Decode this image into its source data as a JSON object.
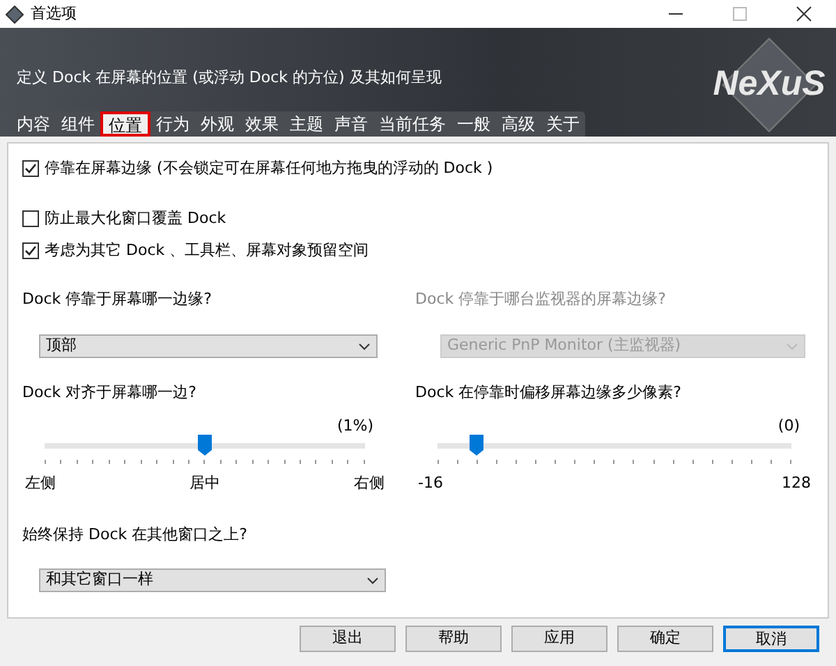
{
  "window": {
    "title": "首选项"
  },
  "header": {
    "description": "定义 Dock 在屏幕的位置 (或浮动 Dock 的方位) 及其如何呈现",
    "logo": "NeXuS"
  },
  "tabs": [
    {
      "label": "内容",
      "selected": false
    },
    {
      "label": "组件",
      "selected": false
    },
    {
      "label": "位置",
      "selected": true
    },
    {
      "label": "行为",
      "selected": false
    },
    {
      "label": "外观",
      "selected": false
    },
    {
      "label": "效果",
      "selected": false
    },
    {
      "label": "主题",
      "selected": false
    },
    {
      "label": "声音",
      "selected": false
    },
    {
      "label": "当前任务",
      "selected": false
    },
    {
      "label": "一般",
      "selected": false
    },
    {
      "label": "高级",
      "selected": false
    },
    {
      "label": "关于",
      "selected": false
    }
  ],
  "checkboxes": [
    {
      "label": "停靠在屏幕边缘 (不会锁定可在屏幕任何地方拖曳的浮动的 Dock )",
      "checked": true
    },
    {
      "label": "防止最大化窗口覆盖 Dock",
      "checked": false
    },
    {
      "label": "考虑为其它 Dock 、工具栏、屏幕对象预留空间",
      "checked": true
    }
  ],
  "edge_select": {
    "label": "Dock 停靠于屏幕哪一边缘?",
    "value": "顶部",
    "disabled": false
  },
  "monitor_select": {
    "label": "Dock 停靠于哪台监视器的屏幕边缘?",
    "value": "Generic PnP Monitor (主监视器)",
    "disabled": true
  },
  "sliders": [
    {
      "label": "Dock 对齐于屏幕哪一边?",
      "reading": "(1%)",
      "level": 0.5,
      "scale": [
        "左侧",
        "居中",
        "右侧"
      ]
    },
    {
      "label": "Dock 在停靠时偏移屏幕边缘多少像素?",
      "reading": "(0)",
      "level": 0.11,
      "scale": [
        "-16",
        "128"
      ]
    }
  ],
  "ontop_select": {
    "label": "始终保持 Dock 在其他窗口之上?",
    "value": "和其它窗口一样",
    "disabled": false
  },
  "buttons": [
    {
      "label": "退出",
      "selected": false
    },
    {
      "label": "帮助",
      "selected": false
    },
    {
      "label": "应用",
      "selected": false
    },
    {
      "label": "确定",
      "selected": false
    },
    {
      "label": "取消",
      "selected": true
    }
  ]
}
